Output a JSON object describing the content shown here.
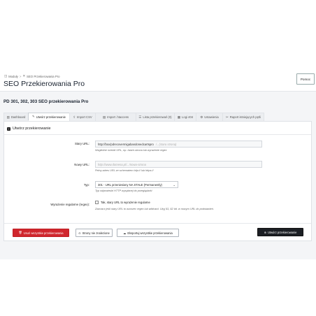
{
  "breadcrumb": {
    "home": "Moduły",
    "current": "SEO Przekierowania Pro"
  },
  "page_title": "SEO Przekierowania Pro",
  "help_button": "Pomoc",
  "module_title": "PD 301, 302, 303 SEO przekierowania Pro",
  "tabs": [
    {
      "label": "Dashboard",
      "icon": "chart-icon"
    },
    {
      "label": "Utwórz przekierowanie",
      "icon": "edit-icon"
    },
    {
      "label": "Import CSV",
      "icon": "upload-icon"
    },
    {
      "label": "Import .htaccess",
      "icon": "file-icon"
    },
    {
      "label": "Lista przekierowań (0)",
      "icon": "list-icon"
    },
    {
      "label": "Logi 404",
      "icon": "log-icon"
    },
    {
      "label": "Ustawienia",
      "icon": "gear-icon"
    },
    {
      "label": "Raport istniejących pętli",
      "icon": "wrench-icon"
    }
  ],
  "panel": {
    "title": "Utwórz przekierowanie",
    "old_url": {
      "label": "Stary URL:",
      "prefix": "http://box/pdrecovermigabandonedcartspro",
      "placeholder": "/...(stara strona)",
      "help": "Wzgledne ścieżki URL, np. /stare-strona lub wyrażenie regex"
    },
    "new_url": {
      "label": "Nowy URL:",
      "placeholder": "http://www.domena.pl/.../nowa-strona",
      "help": "Pełny adres URL ze schematem http:// lub https://"
    },
    "type": {
      "label": "Typ:",
      "selected": "301 - URL przeniesiony NA STAŁE (Permanently)",
      "help": "Typ odpowiedzi HTTP wysyłanej do przeglądarki"
    },
    "regex": {
      "label": "Wyrażenie regularne (regex):",
      "checkbox_label": "Tak, stary URL to wyrażenie regularne",
      "help": "Zaznacz jeśli stary URL to wzorzec regex lub wildcard. Użyj $1, $2 itd. w nowym URL do podstawień."
    }
  },
  "buttons": {
    "delete_all": "Usuń wszystkie przekierowania",
    "not_found": "Strony nie znalezione",
    "export_all": "Eksportuj wszystkie przekierowania",
    "create": "Utwórz przekierowanie"
  },
  "colors": {
    "danger": "#d0262d",
    "dark": "#1c1f24",
    "accent_text": "#1a2330"
  }
}
